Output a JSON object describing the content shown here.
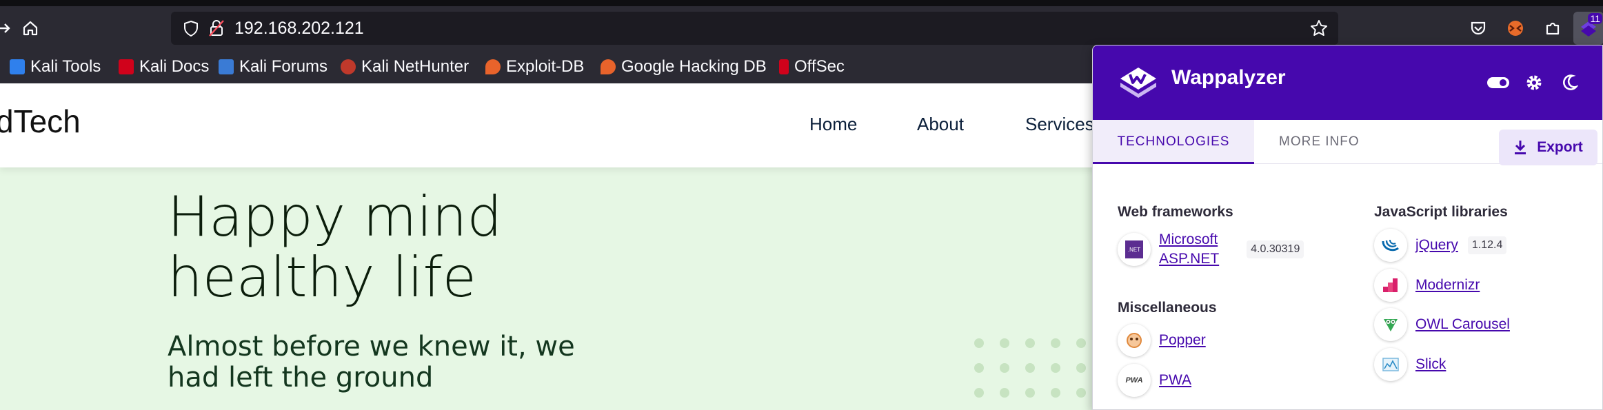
{
  "browser": {
    "url": "192.168.202.121",
    "extension_badge": "11",
    "bookmarks": [
      {
        "label": "Kali Tools",
        "icon": "kali-tools-icon"
      },
      {
        "label": "Kali Docs",
        "icon": "kali-docs-icon"
      },
      {
        "label": "Kali Forums",
        "icon": "kali-forums-icon"
      },
      {
        "label": "Kali NetHunter",
        "icon": "kali-nethunter-icon"
      },
      {
        "label": "Exploit-DB",
        "icon": "exploit-db-icon"
      },
      {
        "label": "Google Hacking DB",
        "icon": "ghdb-icon"
      },
      {
        "label": "OffSec",
        "icon": "offsec-icon"
      }
    ]
  },
  "site": {
    "brand": "dTech",
    "nav": [
      "Home",
      "About",
      "Services"
    ],
    "hero_title_line1": "Happy mind",
    "hero_title_line2": "healthy life",
    "hero_sub_line1": "Almost before we knew it, we",
    "hero_sub_line2": "had left the ground"
  },
  "wappalyzer": {
    "title": "Wappalyzer",
    "tabs": {
      "technologies": "TECHNOLOGIES",
      "more_info": "MORE INFO"
    },
    "export_label": "Export",
    "categories": {
      "web_frameworks": {
        "title": "Web frameworks",
        "items": [
          {
            "name_line1": "Microsoft",
            "name_line2": "ASP.NET",
            "version": "4.0.30319",
            "icon": "aspnet-icon"
          }
        ]
      },
      "miscellaneous": {
        "title": "Miscellaneous",
        "items": [
          {
            "name": "Popper",
            "icon": "popper-icon"
          },
          {
            "name": "PWA",
            "icon": "pwa-icon"
          }
        ]
      },
      "javascript_libraries": {
        "title": "JavaScript libraries",
        "items": [
          {
            "name": "jQuery",
            "version": "1.12.4",
            "icon": "jquery-icon"
          },
          {
            "name": "Modernizr",
            "icon": "modernizr-icon"
          },
          {
            "name": "OWL Carousel",
            "icon": "owl-carousel-icon"
          },
          {
            "name": "Slick",
            "icon": "slick-icon"
          }
        ]
      }
    },
    "colors": {
      "brand": "#4608ad"
    }
  }
}
